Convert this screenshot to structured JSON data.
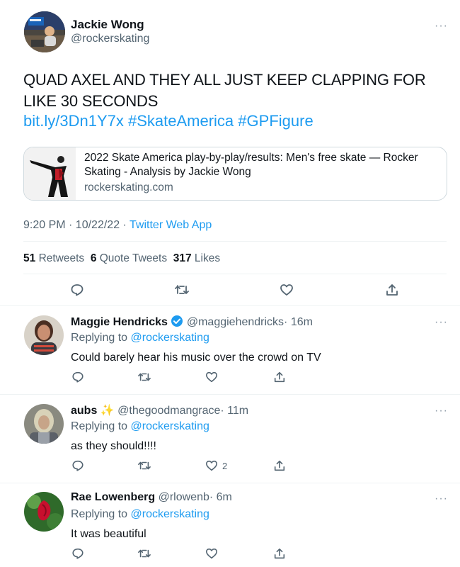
{
  "main_tweet": {
    "author_name": "Jackie Wong",
    "author_handle": "@rockerskating",
    "text": "QUAD AXEL AND THEY ALL JUST KEEP CLAPPING FOR LIKE 30 SECONDS",
    "link": "bit.ly/3Dn1Y7x",
    "hashtag1": "#SkateAmerica",
    "hashtag2": "#GPFigure",
    "card_title": "2022 Skate America play-by-play/results: Men's free skate — Rocker Skating - Analysis by Jackie Wong",
    "card_domain": "rockerskating.com",
    "time": "9:20 PM · 10/22/22",
    "source_sep": " · ",
    "source": "Twitter Web App",
    "stats": {
      "retweets_count": "51",
      "retweets_label": "Retweets",
      "quotes_count": "6",
      "quotes_label": "Quote Tweets",
      "likes_count": "317",
      "likes_label": "Likes"
    }
  },
  "replies": [
    {
      "name": "Maggie Hendricks",
      "handle": "@maggiehendricks",
      "time": "· 16m",
      "replying_label": "Replying to",
      "replying_to": "@rockerskating",
      "text": "Could barely hear his music over the crowd on TV",
      "like_count": ""
    },
    {
      "name": "aubs",
      "name_emoji": "✨",
      "handle": "@thegoodmangrace",
      "time": "· 11m",
      "replying_label": "Replying to",
      "replying_to": "@rockerskating",
      "text": "as they should!!!!",
      "like_count": "2"
    },
    {
      "name": "Rae Lowenberg",
      "handle": "@rlowenb",
      "time": "· 6m",
      "replying_label": "Replying to",
      "replying_to": "@rockerskating",
      "text": "It was beautiful",
      "like_count": ""
    }
  ],
  "more_glyph": "···",
  "colors": {
    "link": "#1d9bf0",
    "muted": "#536471",
    "verified": "#1d9bf0"
  }
}
